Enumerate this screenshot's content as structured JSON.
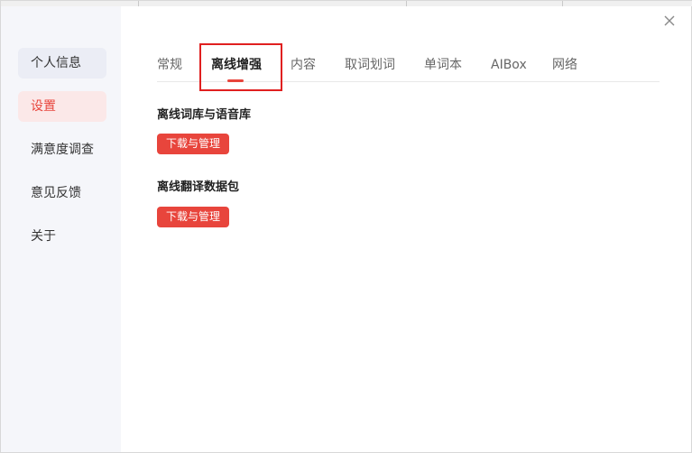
{
  "sidebar": {
    "items": [
      {
        "label": "个人信息"
      },
      {
        "label": "设置"
      },
      {
        "label": "满意度调查"
      },
      {
        "label": "意见反馈"
      },
      {
        "label": "关于"
      }
    ]
  },
  "tabs": [
    {
      "label": "常规"
    },
    {
      "label": "离线增强"
    },
    {
      "label": "内容"
    },
    {
      "label": "取词划词"
    },
    {
      "label": "单词本"
    },
    {
      "label": "AIBox"
    },
    {
      "label": "网络"
    }
  ],
  "active_tab": "离线增强",
  "sections": [
    {
      "title": "离线词库与语音库",
      "button_label": "下载与管理"
    },
    {
      "title": "离线翻译数据包",
      "button_label": "下载与管理"
    }
  ],
  "colors": {
    "accent": "#e8453c",
    "highlight_box": "#e02020",
    "sidebar_bg": "#f5f6fa",
    "active_item_bg": "#fbe8e8"
  },
  "icons": {
    "close": "close-icon"
  }
}
